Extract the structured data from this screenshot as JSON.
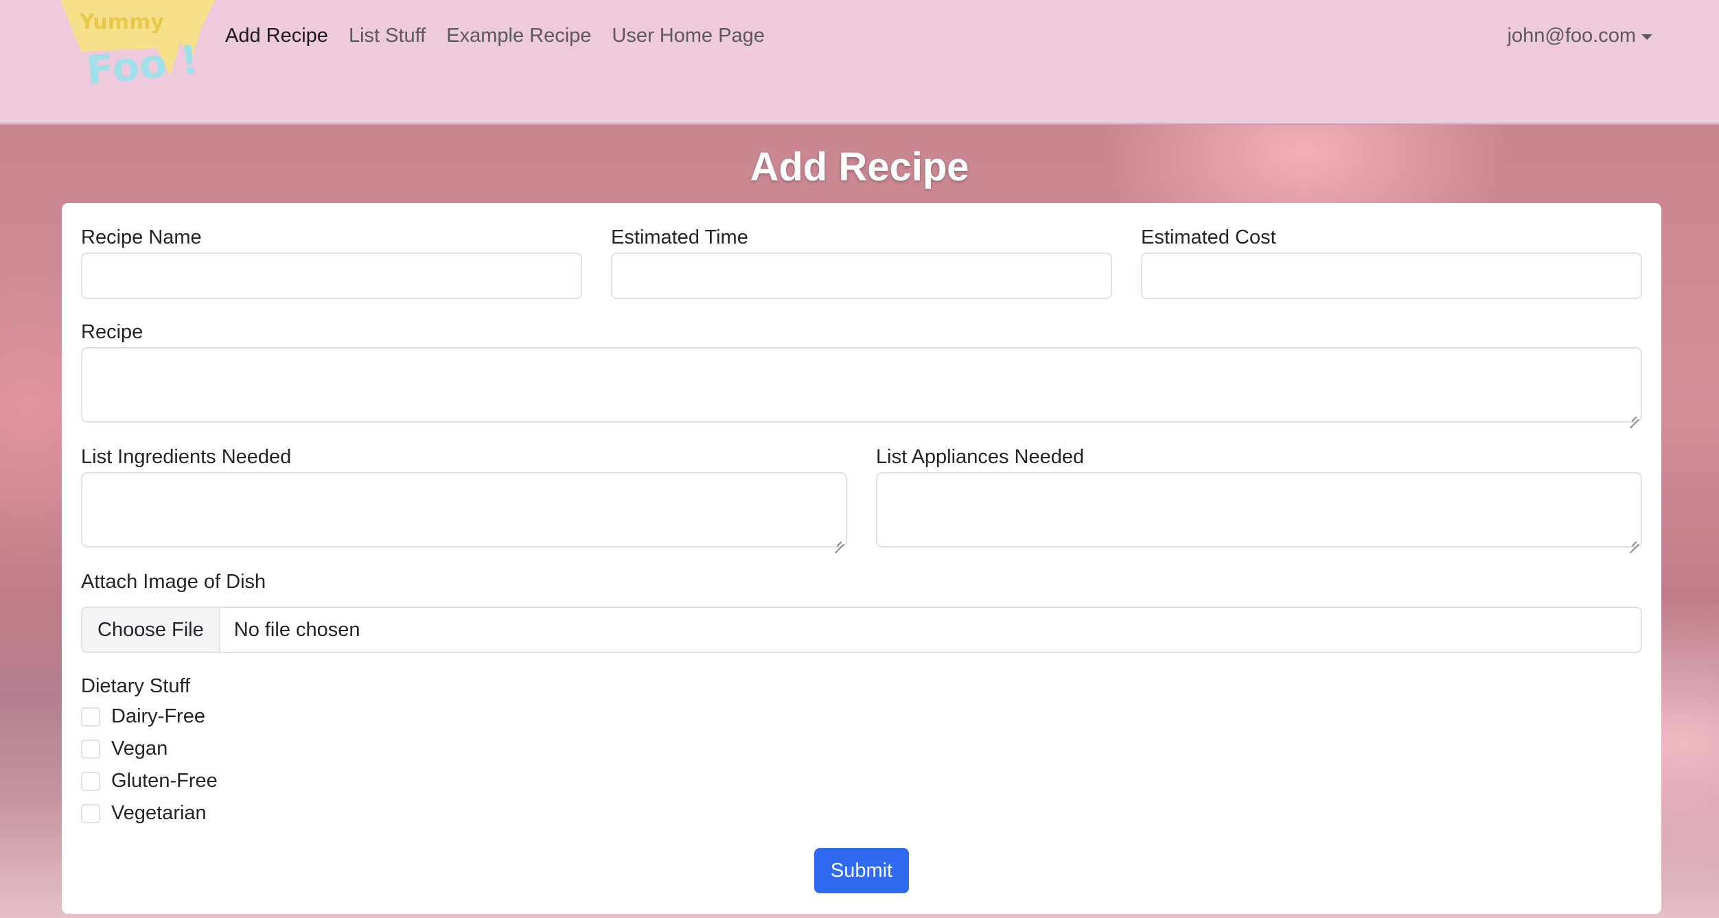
{
  "nav": {
    "logo_text_top": "Yummy",
    "logo_text_bottom": "Foo !",
    "links": [
      "Add Recipe",
      "List Stuff",
      "Example Recipe",
      "User Home Page"
    ],
    "user": "john@foo.com"
  },
  "page": {
    "title": "Add Recipe"
  },
  "form": {
    "recipe_name_label": "Recipe Name",
    "estimated_time_label": "Estimated Time",
    "estimated_cost_label": "Estimated Cost",
    "recipe_label": "Recipe",
    "ingredients_label": "List Ingredients Needed",
    "appliances_label": "List Appliances Needed",
    "image_label": "Attach Image of Dish",
    "file_button": "Choose File",
    "file_status": "No file chosen",
    "dietary_label": "Dietary Stuff",
    "dietary_options": [
      "Dairy-Free",
      "Vegan",
      "Gluten-Free",
      "Vegetarian"
    ],
    "submit_label": "Submit"
  },
  "colors": {
    "navbar": "#efc9dc",
    "submit": "#2f6af0"
  }
}
